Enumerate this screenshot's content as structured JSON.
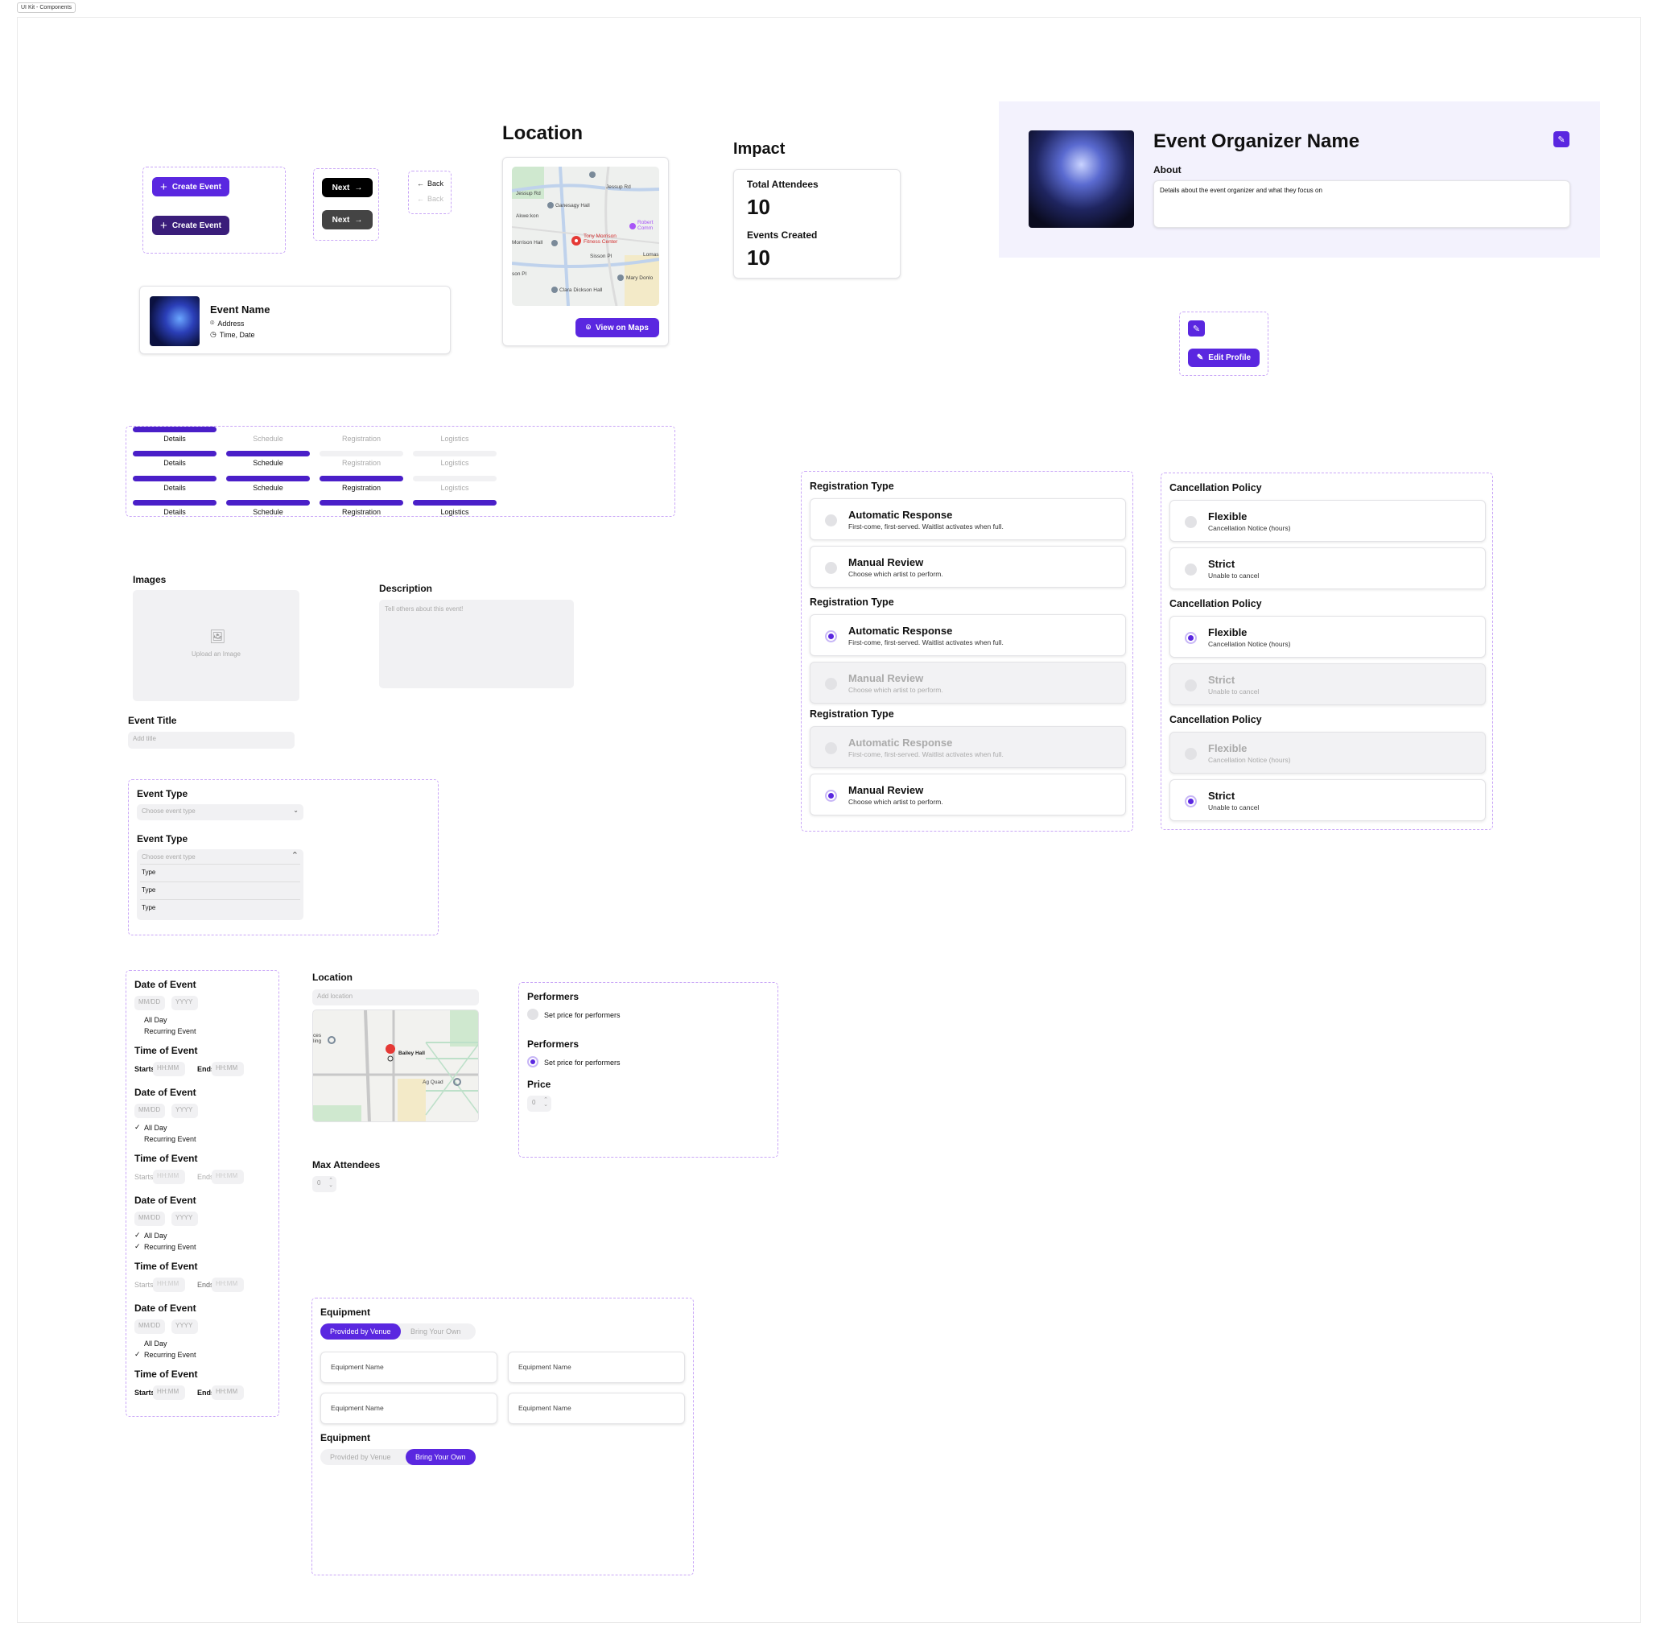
{
  "frame_tag": "UI Kit - Components",
  "buttons": {
    "create_event": "Create Event",
    "next": "Next",
    "back": "Back",
    "view_on_maps": "View on Maps",
    "edit_profile": "Edit Profile"
  },
  "event_card": {
    "name": "Event Name",
    "address": "Address",
    "time": "Time, Date"
  },
  "location": {
    "title": "Location",
    "map_labels": {
      "gateway": "Jessup Rd",
      "gamma": "Ganesagy Hall",
      "tony": "Tony Morrison Fitness Center",
      "morrison": "Morrison Hall",
      "robert": "Robert Comm",
      "clara": "Clara Dickson Hall",
      "mary": "Mary Donlo",
      "jessup2": "Jessup Rd",
      "aknw": "Akwe:kon",
      "sisson": "Sisson Pl",
      "lomas": "Lomas",
      "son": "son Pl"
    }
  },
  "impact": {
    "title": "Impact",
    "total_label": "Total Attendees",
    "total_value": "10",
    "events_label": "Events Created",
    "events_value": "10"
  },
  "organizer": {
    "name": "Event Organizer Name",
    "about_label": "About",
    "about_text": "Details about the event organizer and what they focus on"
  },
  "progress": {
    "steps": [
      "Details",
      "Schedule",
      "Registration",
      "Logistics"
    ]
  },
  "images": {
    "label": "Images",
    "upload": "Upload an Image"
  },
  "description": {
    "label": "Description",
    "placeholder": "Tell others about this event!"
  },
  "event_title": {
    "label": "Event Title",
    "placeholder": "Add title"
  },
  "event_type": {
    "label": "Event Type",
    "placeholder": "Choose event type",
    "options": [
      "Type",
      "Type",
      "Type"
    ]
  },
  "date_time": {
    "date_label": "Date of Event",
    "mm": "MM/DD",
    "yyyy": "YYYY",
    "all_day": "All Day",
    "recurring": "Recurring Event",
    "time_label": "Time of Event",
    "starts": "Starts",
    "ends": "Ends",
    "hhmm": "HH:MM"
  },
  "location_form": {
    "label": "Location",
    "placeholder": "Add location",
    "bailey": "Bailey Hall",
    "agquad": "Ag Quad",
    "ces": "ces ling"
  },
  "max_attendees": {
    "label": "Max Attendees",
    "value": "0"
  },
  "performers": {
    "label": "Performers",
    "set_price": "Set price for performers",
    "price_label": "Price",
    "price_value": "0"
  },
  "equipment": {
    "label": "Equipment",
    "tab_venue": "Provided by Venue",
    "tab_own": "Bring Your Own",
    "name_placeholder": "Equipment Name"
  },
  "registration": {
    "label": "Registration Type",
    "auto_title": "Automatic Response",
    "auto_sub": "First-come, first-served. Waitlist activates when full.",
    "manual_title": "Manual Review",
    "manual_sub": "Choose which artist to perform."
  },
  "cancellation": {
    "label": "Cancellation Policy",
    "flex_title": "Flexible",
    "flex_sub": "Cancellation Notice (hours)",
    "strict_title": "Strict",
    "strict_sub": "Unable to cancel"
  },
  "colors": {
    "accent": "#5a27e0",
    "accent_dark": "#3a1d7a",
    "bar": "#4a1fc8"
  }
}
